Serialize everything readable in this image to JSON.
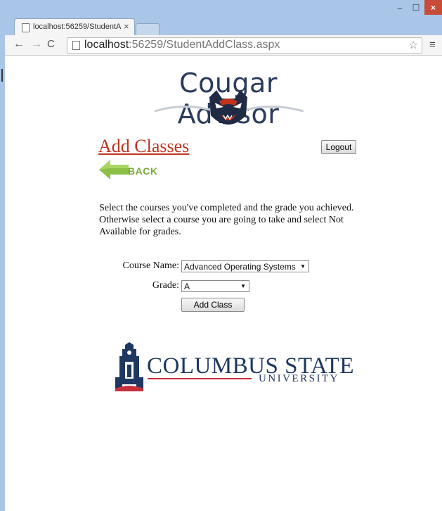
{
  "browser": {
    "tab_title": "localhost:56259/StudentA",
    "url_host": "localhost",
    "url_rest": ":56259/StudentAddClass.aspx",
    "icons": [
      "back-arrow-icon",
      "forward-arrow-icon",
      "reload-icon",
      "page-icon",
      "star-icon",
      "menu-icon"
    ]
  },
  "header": {
    "logo_text": "Cougar Advisor"
  },
  "page": {
    "title": "Add Classes",
    "logout_label": "Logout",
    "back_label": "BACK",
    "instructions": "Select the courses you've completed and the grade you achieved. Otherwise select a course you are going to take and select Not Available for grades."
  },
  "form": {
    "course_label": "Course Name:",
    "course_value": "Advanced Operating Systems",
    "grade_label": "Grade:",
    "grade_value": "A",
    "add_button": "Add Class"
  },
  "footer_logo": {
    "name": "COLUMBUS STATE",
    "sub": "UNIVERSITY"
  },
  "colors": {
    "title_red": "#c0341f",
    "back_green": "#7aa93a",
    "csu_navy": "#1f3761",
    "csu_red": "#c62f3b"
  }
}
